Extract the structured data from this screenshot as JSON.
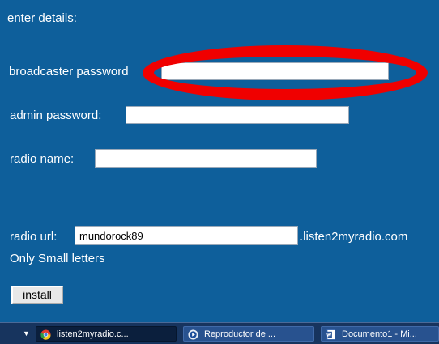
{
  "form": {
    "heading": "enter details:",
    "broadcaster_password_label": "broadcaster password",
    "admin_password_label": "admin password:",
    "radio_name_label": "radio name:",
    "radio_url_label": "radio url:",
    "radio_url_value": "mundorock89",
    "domain_suffix": ".listen2myradio.com",
    "hint": "Only Small letters",
    "install_button": "install"
  },
  "annotation": {
    "color": "#f00000"
  },
  "taskbar": {
    "tasks": [
      {
        "label": "listen2myradio.c...",
        "icon": "chrome-icon",
        "active": true
      },
      {
        "label": "Reproductor de ...",
        "icon": "media-player-icon",
        "active": false
      },
      {
        "label": "Documento1 - Mi...",
        "icon": "word-document-icon",
        "active": false
      }
    ]
  },
  "colors": {
    "page_background": "#0e5f9b",
    "taskbar_background": "#17345e"
  }
}
